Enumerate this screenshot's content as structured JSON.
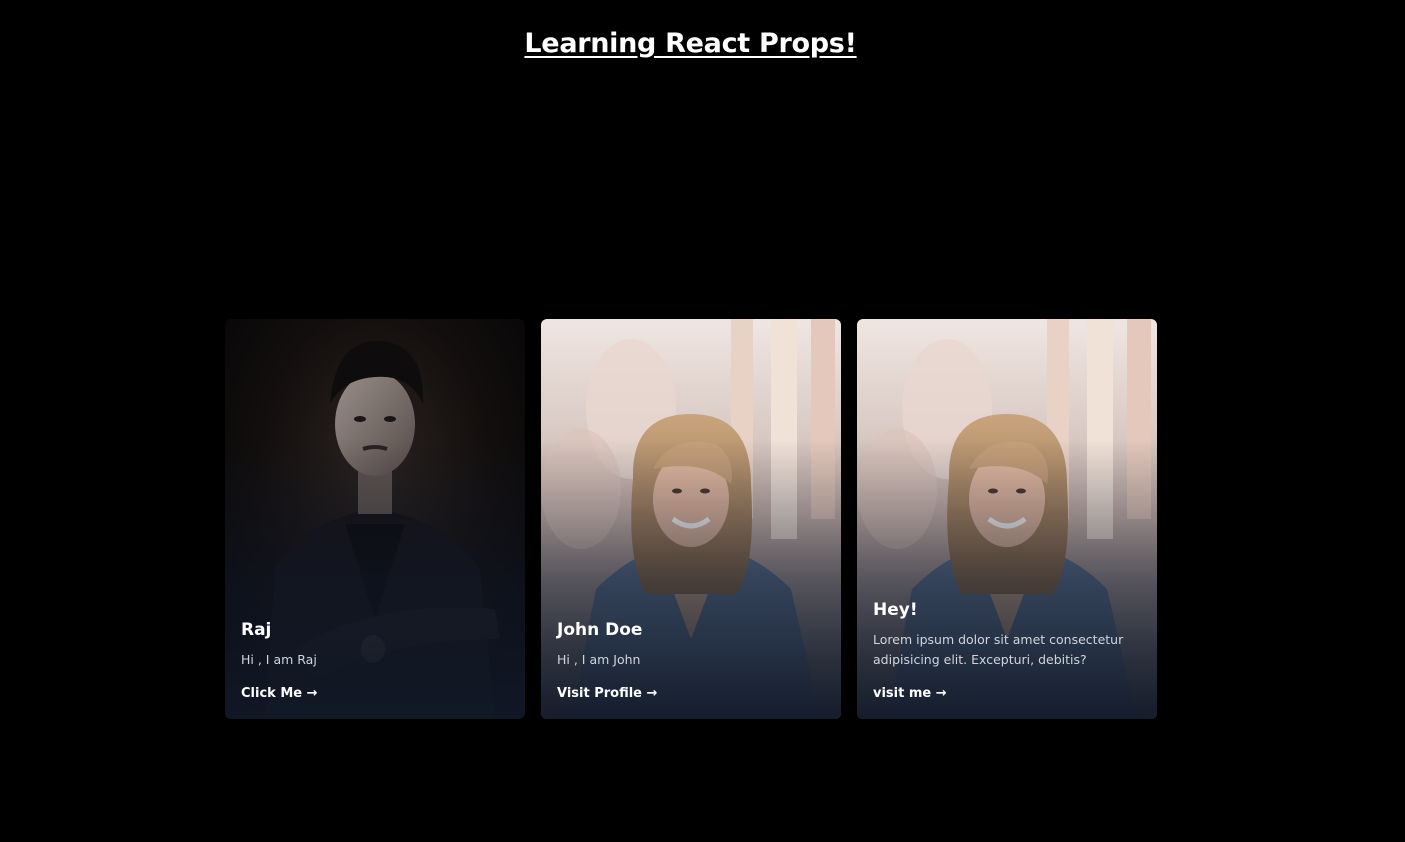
{
  "page": {
    "title": "Learning React Props!"
  },
  "cards": [
    {
      "name": "Raj",
      "description": "Hi , I am Raj",
      "link_label": "Click Me →",
      "photo": "portrait-man-dark-suit"
    },
    {
      "name": "John Doe",
      "description": "Hi , I am John",
      "link_label": "Visit Profile →",
      "photo": "portrait-woman-denim-jacket"
    },
    {
      "name": "Hey!",
      "description": "Lorem ipsum dolor sit amet consectetur adipisicing elit. Excepturi, debitis?",
      "link_label": "visit me →",
      "photo": "portrait-woman-denim-jacket"
    }
  ],
  "colors": {
    "background": "#000000",
    "card_overlay": "#111827",
    "text": "#ffffff",
    "muted_text": "#d1d5db"
  }
}
